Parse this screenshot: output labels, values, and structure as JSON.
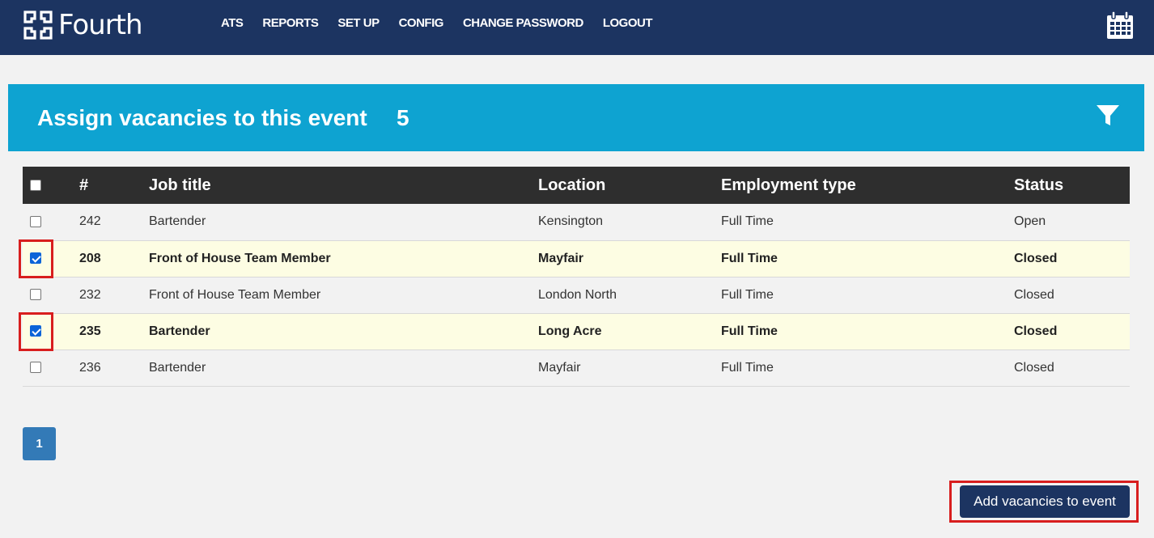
{
  "brand": {
    "name": "Fourth"
  },
  "nav": {
    "items": [
      {
        "label": "ATS"
      },
      {
        "label": "REPORTS"
      },
      {
        "label": "SET UP"
      },
      {
        "label": "CONFIG"
      },
      {
        "label": "CHANGE PASSWORD"
      },
      {
        "label": "LOGOUT"
      }
    ],
    "right_icon": "calendar-icon"
  },
  "panel": {
    "title": "Assign vacancies to this event",
    "count": "5",
    "filter_icon": "filter-icon",
    "accent_color": "#0ea3d1"
  },
  "table": {
    "columns": [
      "#",
      "Job title",
      "Location",
      "Employment type",
      "Status"
    ],
    "rows": [
      {
        "checked": false,
        "id": "242",
        "title": "Bartender",
        "location": "Kensington",
        "type": "Full Time",
        "status": "Open"
      },
      {
        "checked": true,
        "id": "208",
        "title": "Front of House Team Member",
        "location": "Mayfair",
        "type": "Full Time",
        "status": "Closed"
      },
      {
        "checked": false,
        "id": "232",
        "title": "Front of House Team Member",
        "location": "London North",
        "type": "Full Time",
        "status": "Closed"
      },
      {
        "checked": true,
        "id": "235",
        "title": "Bartender",
        "location": "Long Acre",
        "type": "Full Time",
        "status": "Closed"
      },
      {
        "checked": false,
        "id": "236",
        "title": "Bartender",
        "location": "Mayfair",
        "type": "Full Time",
        "status": "Closed"
      }
    ]
  },
  "pagination": {
    "current": "1"
  },
  "actions": {
    "add_label": "Add vacancies to event"
  },
  "colors": {
    "nav_bg": "#1c3461",
    "highlight": "#d81e1e",
    "selected_row": "#fdfde3"
  }
}
